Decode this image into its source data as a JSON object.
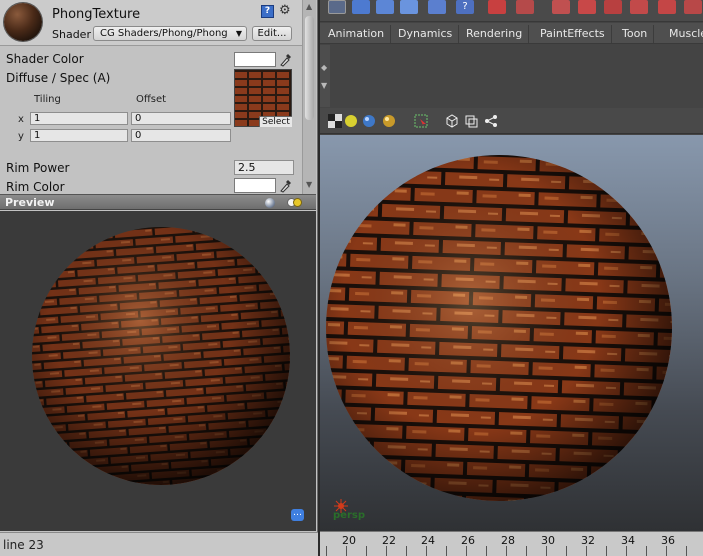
{
  "inspector": {
    "title": "PhongTexture",
    "shader_label": "Shader",
    "shader_value": "CG Shaders/Phong/Phong",
    "edit_label": "Edit...",
    "properties": {
      "shader_color_label": "Shader Color",
      "diffuse_label": "Diffuse / Spec (A)",
      "tiling_label": "Tiling",
      "offset_label": "Offset",
      "x_label": "x",
      "y_label": "y",
      "tiling_x": "1",
      "tiling_y": "1",
      "offset_x": "0",
      "offset_y": "0",
      "texture_select_label": "Select",
      "rim_power_label": "Rim Power",
      "rim_power_value": "2.5",
      "rim_color_label": "Rim Color"
    },
    "preview_title": "Preview",
    "status_text": "line 23"
  },
  "maya": {
    "shelf_tabs": [
      "Animation",
      "Dynamics",
      "Rendering",
      "PaintEffects",
      "Toon",
      "Muscle"
    ],
    "viewport_label": "persp",
    "timeline_labels": [
      "20",
      "22",
      "24",
      "26",
      "28",
      "30",
      "32",
      "34",
      "36"
    ]
  },
  "colors": {
    "brick": "#8a3a1c",
    "mortar": "#2a1a12",
    "viewport_top": "#8898ad",
    "viewport_bottom": "#2f3134",
    "persp_label": "#2a6e2a"
  }
}
